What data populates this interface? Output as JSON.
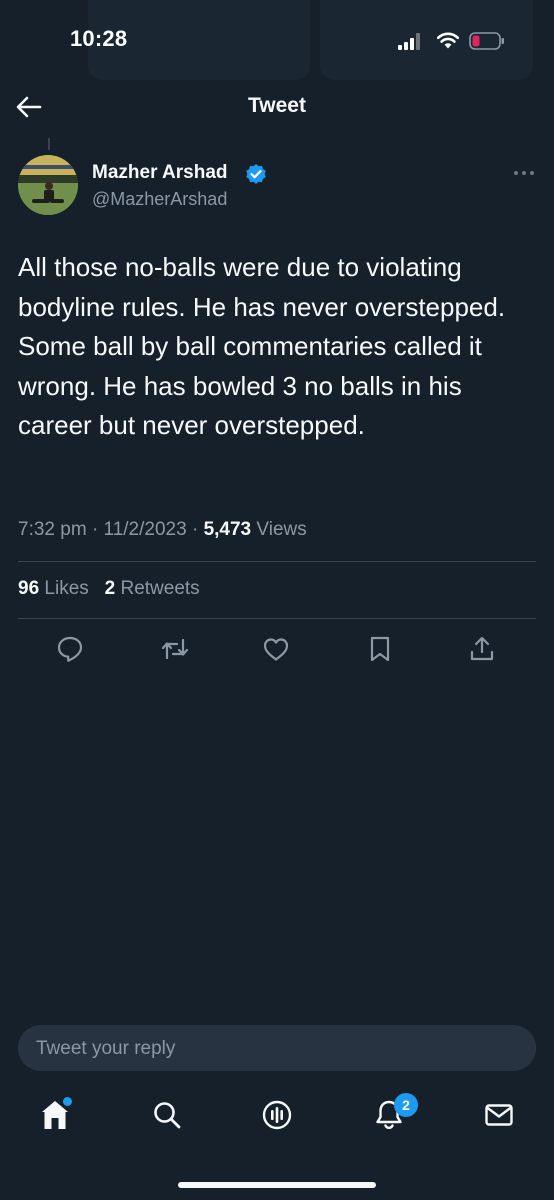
{
  "status_bar": {
    "time": "10:28"
  },
  "header": {
    "title": "Tweet"
  },
  "tweet": {
    "author_name": "Mazher Arshad",
    "handle": "@MazherArshad",
    "text": "All those no-balls were due to violating bodyline rules. He has never overstepped. Some ball by ball commentaries called it wrong. He has bowled 3 no balls in his career but never overstepped.",
    "time": "7:32 pm",
    "date": "11/2/2023",
    "separator": "·",
    "views_count": "5,473",
    "views_label": "Views",
    "likes_count": "96",
    "likes_label": "Likes",
    "retweets_count": "2",
    "retweets_label": "Retweets"
  },
  "actions": [
    "reply-icon",
    "retweet-icon",
    "like-icon",
    "bookmark-icon",
    "share-icon"
  ],
  "reply": {
    "placeholder": "Tweet your reply"
  },
  "bottom_nav": {
    "items": [
      "home-icon",
      "search-icon",
      "spaces-icon",
      "notifications-icon",
      "messages-icon"
    ],
    "notifications_badge": "2"
  },
  "colors": {
    "background": "#15202b",
    "text": "#f7f9f9",
    "secondary_text": "#8b98a5",
    "accent": "#1d9bf0",
    "divider": "#38444d",
    "battery_low": "#e0245e"
  }
}
